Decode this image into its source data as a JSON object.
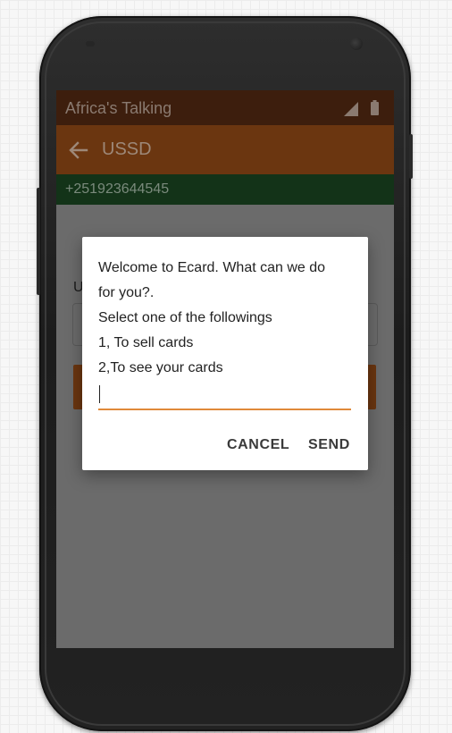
{
  "statusbar": {
    "app_name": "Africa's Talking"
  },
  "toolbar": {
    "title": "USSD"
  },
  "phonebar": {
    "number": "+251923644545"
  },
  "background": {
    "label": "U"
  },
  "dialog": {
    "lines": [
      "Welcome to Ecard. What can we do",
      "for you?.",
      "Select one of the followings",
      "1, To sell cards",
      "2,To see your cards"
    ],
    "input_value": "",
    "cancel_label": "CANCEL",
    "send_label": "SEND"
  },
  "colors": {
    "accent": "#e08a3a",
    "toolbar": "#6b3610",
    "statusbar": "#3d1e0d",
    "phonebar": "#133318"
  },
  "icons": [
    "signal-icon",
    "battery-icon",
    "back-arrow-icon"
  ]
}
